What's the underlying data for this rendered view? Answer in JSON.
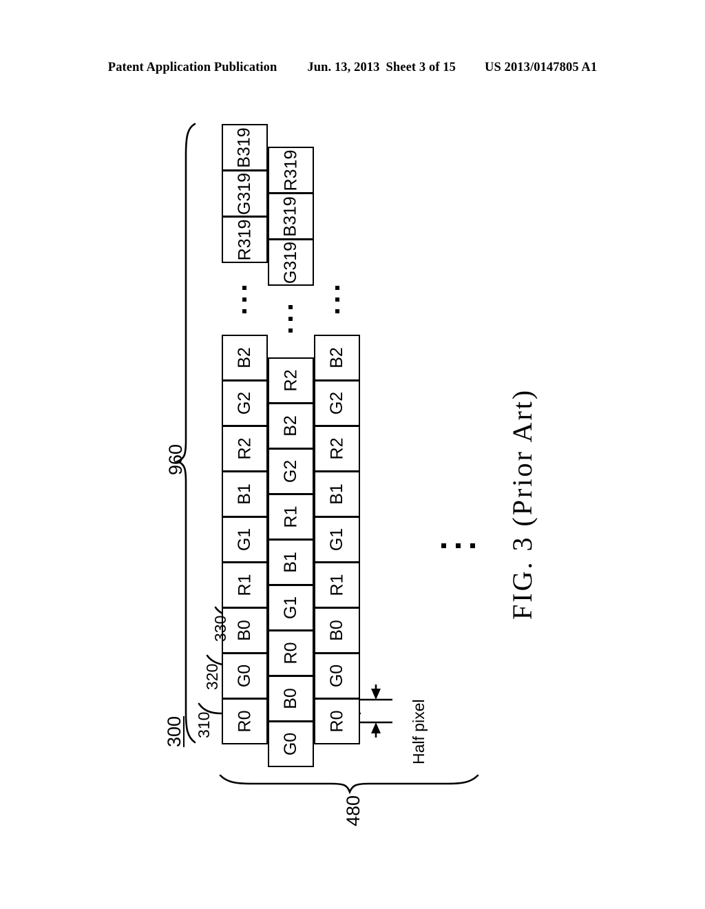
{
  "header": {
    "publication": "Patent Application Publication",
    "date": "Jun. 13, 2013",
    "sheet": "Sheet 3 of 15",
    "patent_number": "US 2013/0147805 A1"
  },
  "figure": {
    "caption": "FIG. 3 (Prior Art)",
    "assembly_label": "300",
    "vertical_brace_label": "960",
    "horizontal_brace_label": "480",
    "half_pixel_label": "Half pixel",
    "leader_labels": [
      "310",
      "320",
      "330"
    ]
  },
  "columns": {
    "col1_top": [
      "B319",
      "G319",
      "R319"
    ],
    "col2_top": [
      "R319",
      "B319",
      "G319"
    ],
    "col1_main": [
      "B2",
      "G2",
      "R2",
      "B1",
      "G1",
      "R1",
      "B0",
      "G0",
      "R0"
    ],
    "col2_main": [
      "R2",
      "B2",
      "G2",
      "R1",
      "B1",
      "G1",
      "R0",
      "B0",
      "G0"
    ],
    "col3_main": [
      "B2",
      "G2",
      "R2",
      "B1",
      "G1",
      "R1",
      "B0",
      "G0",
      "R0"
    ]
  },
  "ellipsis": {
    "glyph": "vertical-ellipsis",
    "horizontal_glyph": "horizontal-ellipsis"
  }
}
